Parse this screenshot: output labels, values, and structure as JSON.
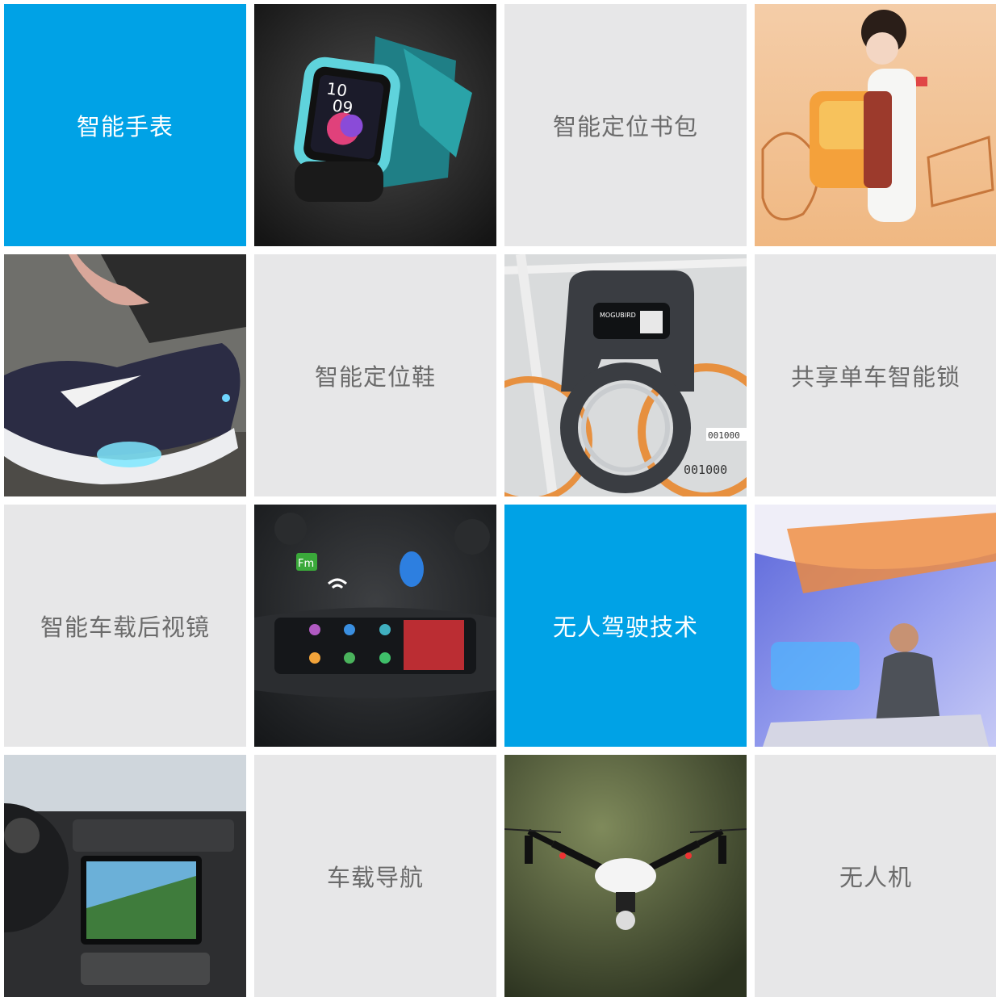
{
  "tiles": {
    "smart_watch": "智能手表",
    "smart_school_bag": "智能定位书包",
    "smart_shoe": "智能定位鞋",
    "bike_lock": "共享单车智能锁",
    "rearview_mirror": "智能车载后视镜",
    "autonomous_driving": "无人驾驶技术",
    "car_navigation": "车载导航",
    "drone": "无人机"
  },
  "photo_text": {
    "watch_time_hours": "10",
    "watch_time_minutes": "09",
    "lock_brand": "MOGUBIRD",
    "lock_serial_1": "001000",
    "lock_serial_2": "001000",
    "mirror_fm": "Fm"
  },
  "colors": {
    "accent_blue": "#00a2e6",
    "label_tile_bg": "#e7e7e8",
    "label_text": "#6b6b6b"
  }
}
